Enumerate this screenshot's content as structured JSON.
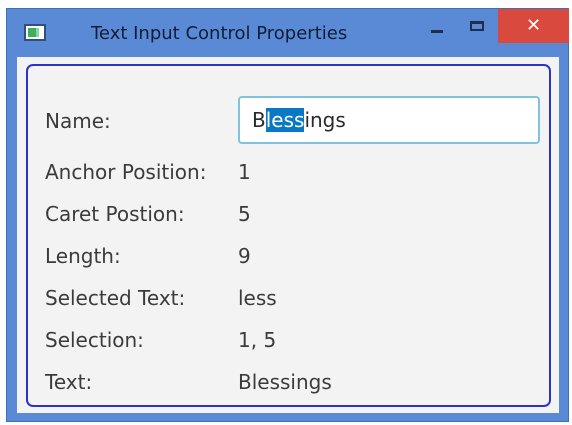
{
  "window": {
    "title": "Text Input Control Properties",
    "minimize_glyph": "–",
    "close_glyph": "✕"
  },
  "form": {
    "name_label": "Name:",
    "name_input": {
      "value": "Blessings",
      "value_before_selection": "B",
      "value_selected": "less",
      "value_after_selection": "ings"
    },
    "rows": [
      {
        "label": "Anchor Position:",
        "value": "1"
      },
      {
        "label": "Caret Postion:",
        "value": "5"
      },
      {
        "label": "Length:",
        "value": "9"
      },
      {
        "label": "Selected Text:",
        "value": "less"
      },
      {
        "label": "Selection:",
        "value": "1, 5"
      },
      {
        "label": "Text:",
        "value": "Blessings"
      }
    ]
  },
  "colors": {
    "titlebar": "#5a8ad6",
    "close_button": "#d9493d",
    "frame_border": "#2b33c9",
    "selection": "#0a79c4",
    "input_focus_border": "#7fc3e0"
  },
  "icons": {
    "app": "app-window-icon",
    "minimize": "minimize-icon",
    "maximize": "maximize-icon",
    "close": "close-icon"
  }
}
